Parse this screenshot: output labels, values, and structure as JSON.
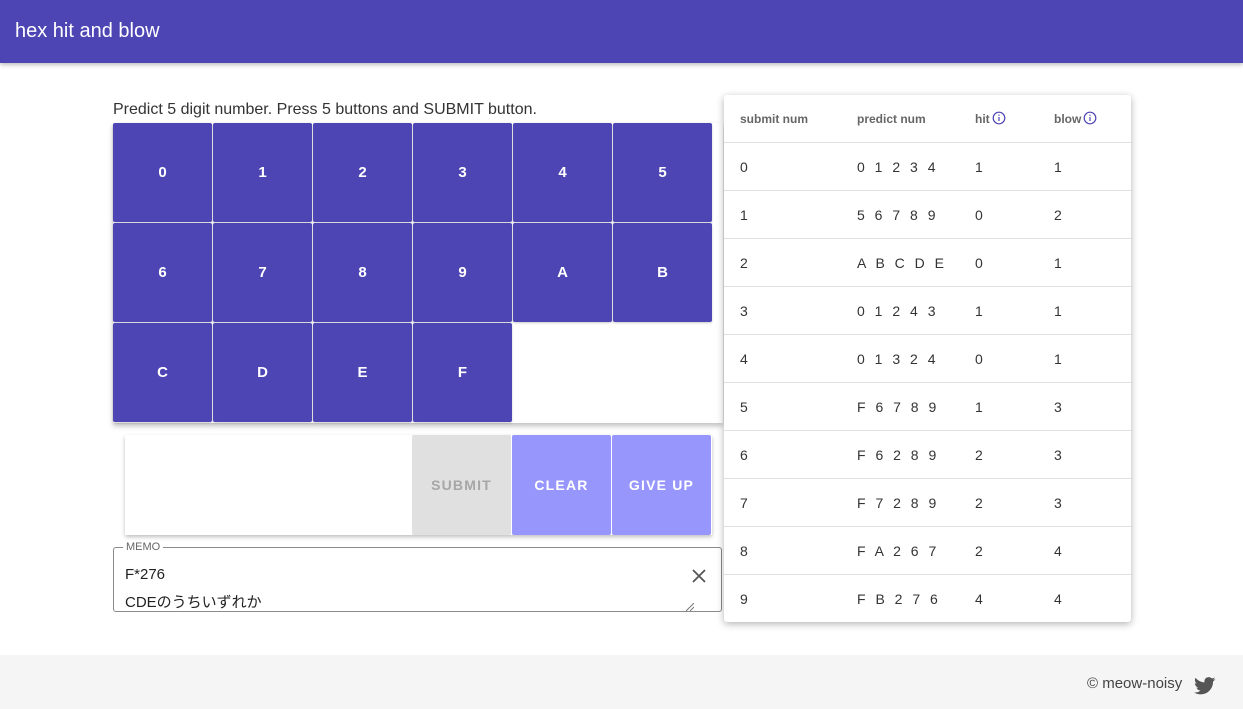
{
  "app": {
    "title": "hex hit and blow"
  },
  "instructions": "Predict 5 digit number. Press 5 buttons and SUBMIT button.",
  "keypad": {
    "keys": [
      "0",
      "1",
      "2",
      "3",
      "4",
      "5",
      "6",
      "7",
      "8",
      "9",
      "A",
      "B",
      "C",
      "D",
      "E",
      "F"
    ]
  },
  "controls": {
    "submit": "SUBMIT",
    "clear": "CLEAR",
    "give_up": "GIVE UP"
  },
  "memo": {
    "label": "MEMO",
    "lines": [
      "F*276",
      "CDEのうちいずれか"
    ]
  },
  "history": {
    "headers": {
      "submit_num": "submit num",
      "predict_num": "predict num",
      "hit": "hit",
      "blow": "blow"
    },
    "rows": [
      {
        "submit": "0",
        "predict": "0 1 2 3 4",
        "hit": "1",
        "blow": "1"
      },
      {
        "submit": "1",
        "predict": "5 6 7 8 9",
        "hit": "0",
        "blow": "2"
      },
      {
        "submit": "2",
        "predict": "A B C D E",
        "hit": "0",
        "blow": "1"
      },
      {
        "submit": "3",
        "predict": "0 1 2 4 3",
        "hit": "1",
        "blow": "1"
      },
      {
        "submit": "4",
        "predict": "0 1 3 2 4",
        "hit": "0",
        "blow": "1"
      },
      {
        "submit": "5",
        "predict": "F 6 7 8 9",
        "hit": "1",
        "blow": "3"
      },
      {
        "submit": "6",
        "predict": "F 6 2 8 9",
        "hit": "2",
        "blow": "3"
      },
      {
        "submit": "7",
        "predict": "F 7 2 8 9",
        "hit": "2",
        "blow": "3"
      },
      {
        "submit": "8",
        "predict": "F A 2 6 7",
        "hit": "2",
        "blow": "4"
      },
      {
        "submit": "9",
        "predict": "F B 2 7 6",
        "hit": "4",
        "blow": "4"
      }
    ]
  },
  "footer": {
    "copyright": "© meow-noisy"
  },
  "colors": {
    "primary": "#4e45b5",
    "accent_light": "#9796fd",
    "disabled": "#e0e0e0"
  }
}
